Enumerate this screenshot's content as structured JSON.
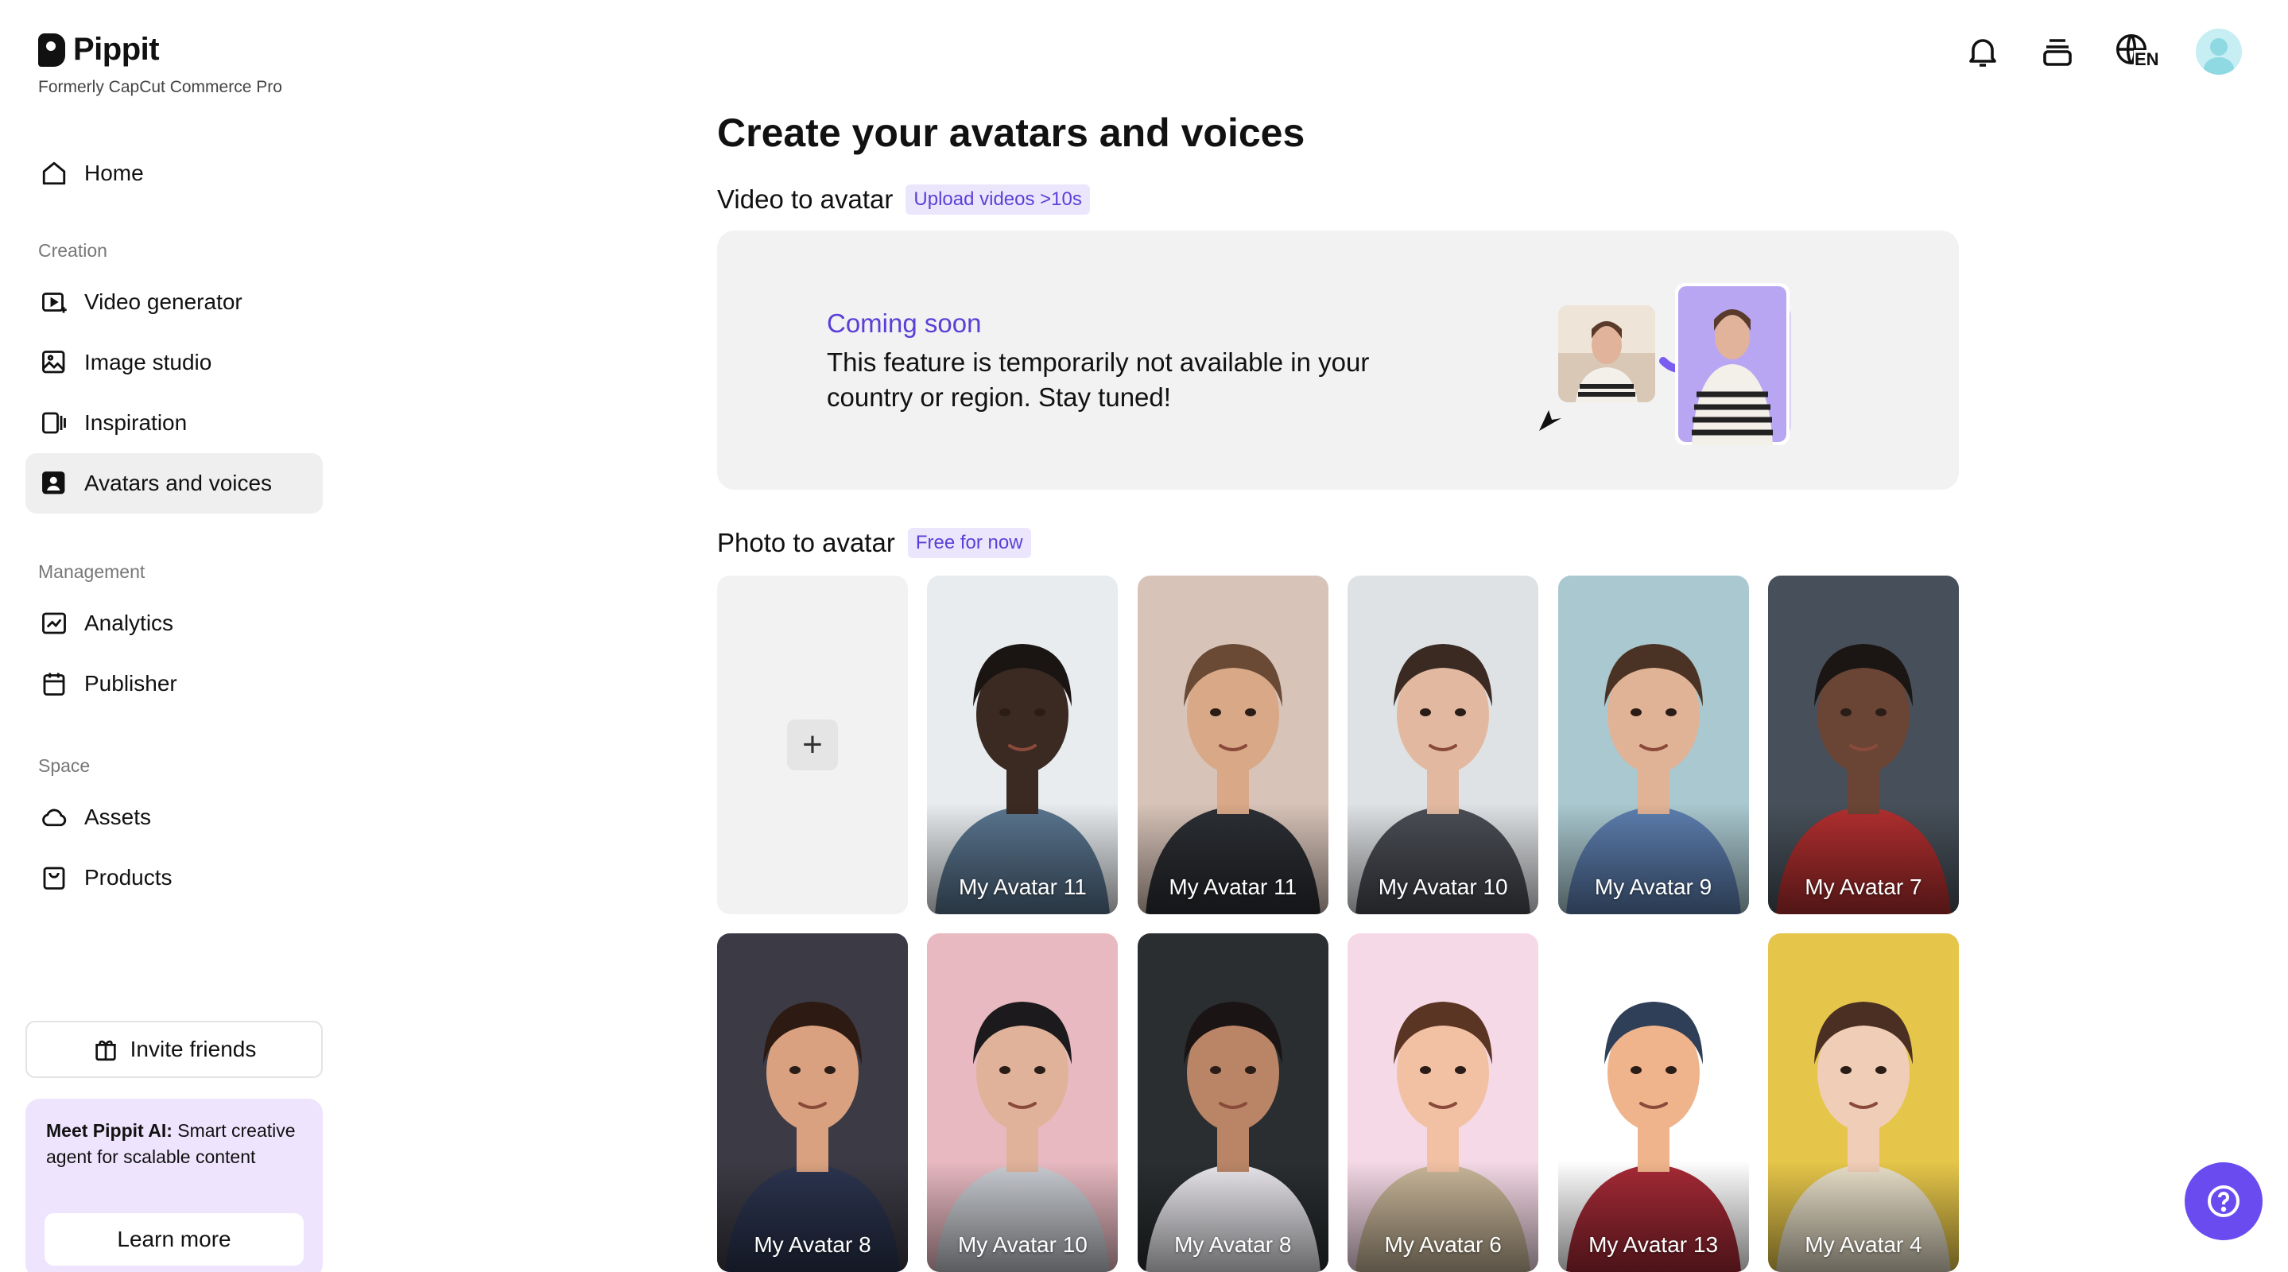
{
  "brand": {
    "name": "Pippit",
    "subtitle": "Formerly CapCut Commerce Pro"
  },
  "sidebar": {
    "home": "Home",
    "sections": {
      "creation": "Creation",
      "management": "Management",
      "space": "Space"
    },
    "creation_items": [
      "Video generator",
      "Image studio",
      "Inspiration",
      "Avatars and voices"
    ],
    "management_items": [
      "Analytics",
      "Publisher"
    ],
    "space_items": [
      "Assets",
      "Products"
    ],
    "active_item": "Avatars and voices",
    "invite_label": "Invite friends",
    "promo": {
      "bold": "Meet Pippit AI:",
      "text": " Smart creative agent for scalable content",
      "button": "Learn more"
    }
  },
  "header": {
    "lang": "EN"
  },
  "main": {
    "title": "Create your avatars and voices",
    "video_section": {
      "title": "Video to avatar",
      "badge": "Upload videos >10s"
    },
    "coming_soon": {
      "heading": "Coming soon",
      "message": "This feature is temporarily not available in your country or region. Stay tuned!"
    },
    "photo_section": {
      "title": "Photo to avatar",
      "badge": "Free for now"
    },
    "add_symbol": "+",
    "avatars": [
      {
        "name": "My Avatar 11",
        "bg": "#e8ecef",
        "skin": "#3b2a22",
        "hair": "#1a1412",
        "top": "#5a7690"
      },
      {
        "name": "My Avatar 11",
        "bg": "#d7c3b8",
        "skin": "#d8a887",
        "hair": "#6b4a35",
        "top": "#2c2f34"
      },
      {
        "name": "My Avatar 10",
        "bg": "#dfe2e5",
        "skin": "#e2b9a0",
        "hair": "#3a2a22",
        "top": "#4b4e55"
      },
      {
        "name": "My Avatar 9",
        "bg": "#a9c8cf",
        "skin": "#e1b396",
        "hair": "#4a3324",
        "top": "#5d7fb0"
      },
      {
        "name": "My Avatar 7",
        "bg": "#47505a",
        "skin": "#6a4535",
        "hair": "#1b1614",
        "top": "#b32f2f"
      },
      {
        "name": "My Avatar 8",
        "bg": "#3c3a44",
        "skin": "#d9a17f",
        "hair": "#2d1a12",
        "top": "#2c3550"
      },
      {
        "name": "My Avatar 10",
        "bg": "#e8b9c1",
        "skin": "#e0b29a",
        "hair": "#1c1a1c",
        "top": "#c9ccd2"
      },
      {
        "name": "My Avatar 8",
        "bg": "#2a2e30",
        "skin": "#b98566",
        "hair": "#1a1514",
        "top": "#e9e7ec"
      },
      {
        "name": "My Avatar 6",
        "bg": "#f5d9e6",
        "skin": "#f2c1a4",
        "hair": "#5b3524",
        "top": "#c9b79a"
      },
      {
        "name": "My Avatar 13",
        "bg": "#ffffff",
        "skin": "#f0b48c",
        "hair": "#2f3f58",
        "top": "#a62a36"
      },
      {
        "name": "My Avatar 4",
        "bg": "#e6c64a",
        "skin": "#f0cdb6",
        "hair": "#4a2f22",
        "top": "#e8dfc8"
      }
    ]
  }
}
